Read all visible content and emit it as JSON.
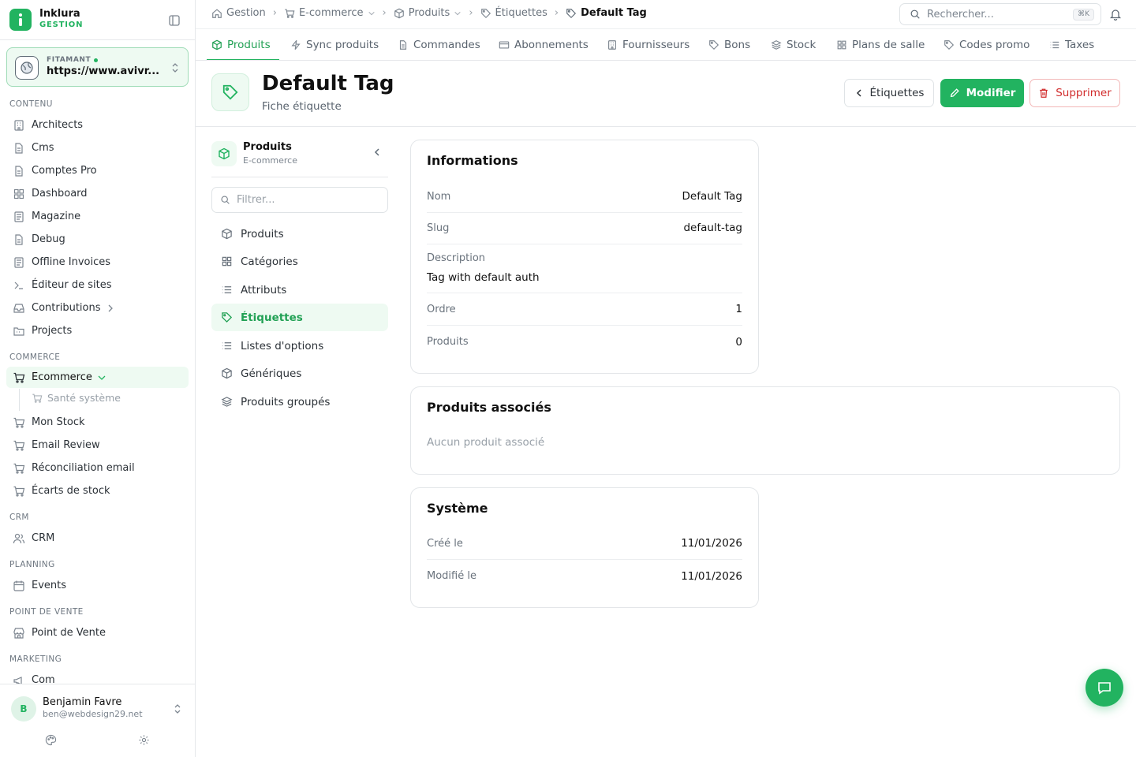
{
  "brand": {
    "name": "Inklura",
    "sub": "GESTION"
  },
  "site": {
    "label": "FITAMANT",
    "url": "https://www.avivr..."
  },
  "sidebar": {
    "sections": [
      {
        "title": "CONTENU"
      },
      {
        "title": "COMMERCE"
      },
      {
        "title": "CRM"
      },
      {
        "title": "PLANNING"
      },
      {
        "title": "POINT DE VENTE"
      },
      {
        "title": "MARKETING"
      }
    ],
    "items": [
      {
        "label": "Architects"
      },
      {
        "label": "Cms"
      },
      {
        "label": "Comptes Pro"
      },
      {
        "label": "Dashboard"
      },
      {
        "label": "Magazine"
      },
      {
        "label": "Debug"
      },
      {
        "label": "Offline Invoices"
      },
      {
        "label": "Éditeur de sites"
      },
      {
        "label": "Contributions"
      },
      {
        "label": "Projects"
      },
      {
        "label": "Ecommerce"
      },
      {
        "label": "Mon Stock"
      },
      {
        "label": "Email Review"
      },
      {
        "label": "Réconciliation email"
      },
      {
        "label": "Écarts de stock"
      },
      {
        "label": "CRM"
      },
      {
        "label": "Events"
      },
      {
        "label": "Point de Vente"
      },
      {
        "label": "Com"
      }
    ],
    "subitem": {
      "label": "Santé système"
    }
  },
  "user": {
    "initial": "B",
    "name": "Benjamin Favre",
    "email": "ben@webdesign29.net"
  },
  "breadcrumb": [
    "Gestion",
    "E-commerce",
    "Produits",
    "Étiquettes",
    "Default Tag"
  ],
  "search": {
    "placeholder": "Rechercher...",
    "shortcut": "⌘K"
  },
  "tabs": [
    "Produits",
    "Sync produits",
    "Commandes",
    "Abonnements",
    "Fournisseurs",
    "Bons",
    "Stock",
    "Plans de salle",
    "Codes promo",
    "Taxes"
  ],
  "page": {
    "title": "Default Tag",
    "subtitle": "Fiche étiquette"
  },
  "actions": {
    "back": "Étiquettes",
    "edit": "Modifier",
    "delete": "Supprimer"
  },
  "subnav": {
    "title": "Produits",
    "subtitle": "E-commerce",
    "filter_placeholder": "Filtrer...",
    "items": [
      "Produits",
      "Catégories",
      "Attributs",
      "Étiquettes",
      "Listes d'options",
      "Génériques",
      "Produits groupés"
    ]
  },
  "info": {
    "title": "Informations",
    "nom_label": "Nom",
    "nom": "Default Tag",
    "slug_label": "Slug",
    "slug": "default-tag",
    "desc_label": "Description",
    "desc": "Tag with default auth",
    "ordre_label": "Ordre",
    "ordre": "1",
    "produits_label": "Produits",
    "produits": "0"
  },
  "associated": {
    "title": "Produits associés",
    "empty": "Aucun produit associé"
  },
  "system": {
    "title": "Système",
    "created_label": "Créé le",
    "created": "11/01/2026",
    "modified_label": "Modifié le",
    "modified": "11/01/2026"
  },
  "colors": {
    "accent": "#22b360",
    "danger": "#d12c2c"
  }
}
